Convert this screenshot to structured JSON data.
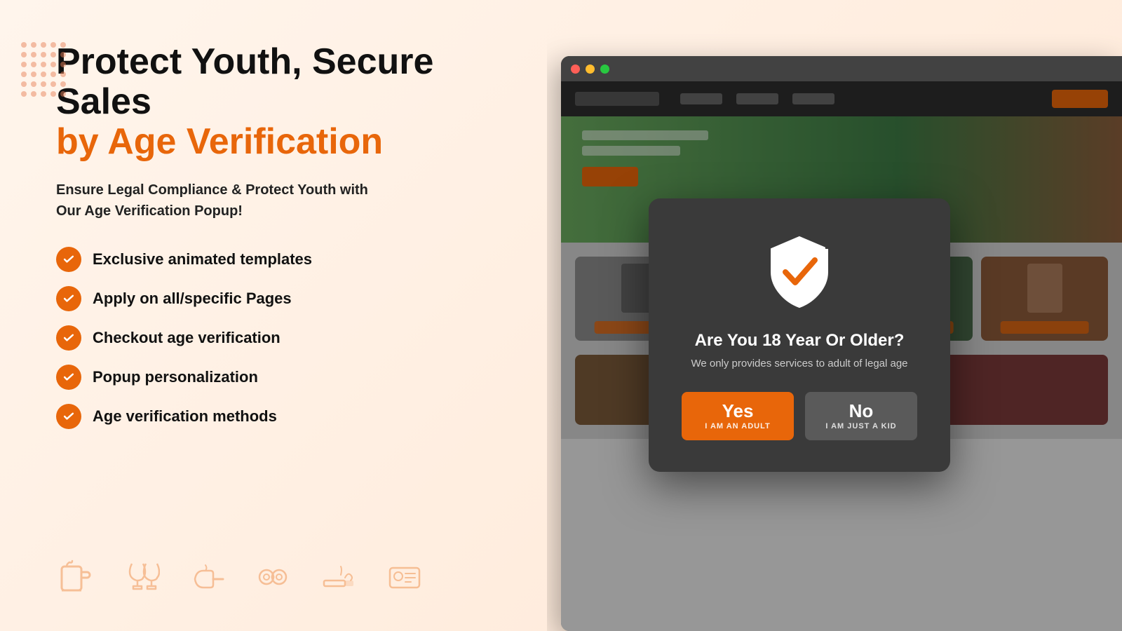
{
  "page": {
    "background": "#fff5ec"
  },
  "left": {
    "headline_black": "Protect Youth, Secure Sales",
    "headline_orange": "by Age Verification",
    "subtitle": "Ensure Legal Compliance & Protect Youth with\nOur Age Verification Popup!",
    "features": [
      "Exclusive animated templates",
      "Apply on all/specific Pages",
      "Checkout age verification",
      "Popup personalization",
      "Age verification methods"
    ],
    "icons": [
      "beer",
      "wine-glass",
      "cigarette",
      "handcuffs",
      "smoke",
      "id-card"
    ]
  },
  "modal": {
    "title": "Are You 18 Year Or Older?",
    "subtitle": "We only provides services to adult of legal age",
    "yes_label": "Yes",
    "yes_sublabel": "I AM AN ADULT",
    "no_label": "No",
    "no_sublabel": "I AM JUST A KID"
  },
  "browser": {
    "dots": [
      "red",
      "yellow",
      "green"
    ]
  }
}
